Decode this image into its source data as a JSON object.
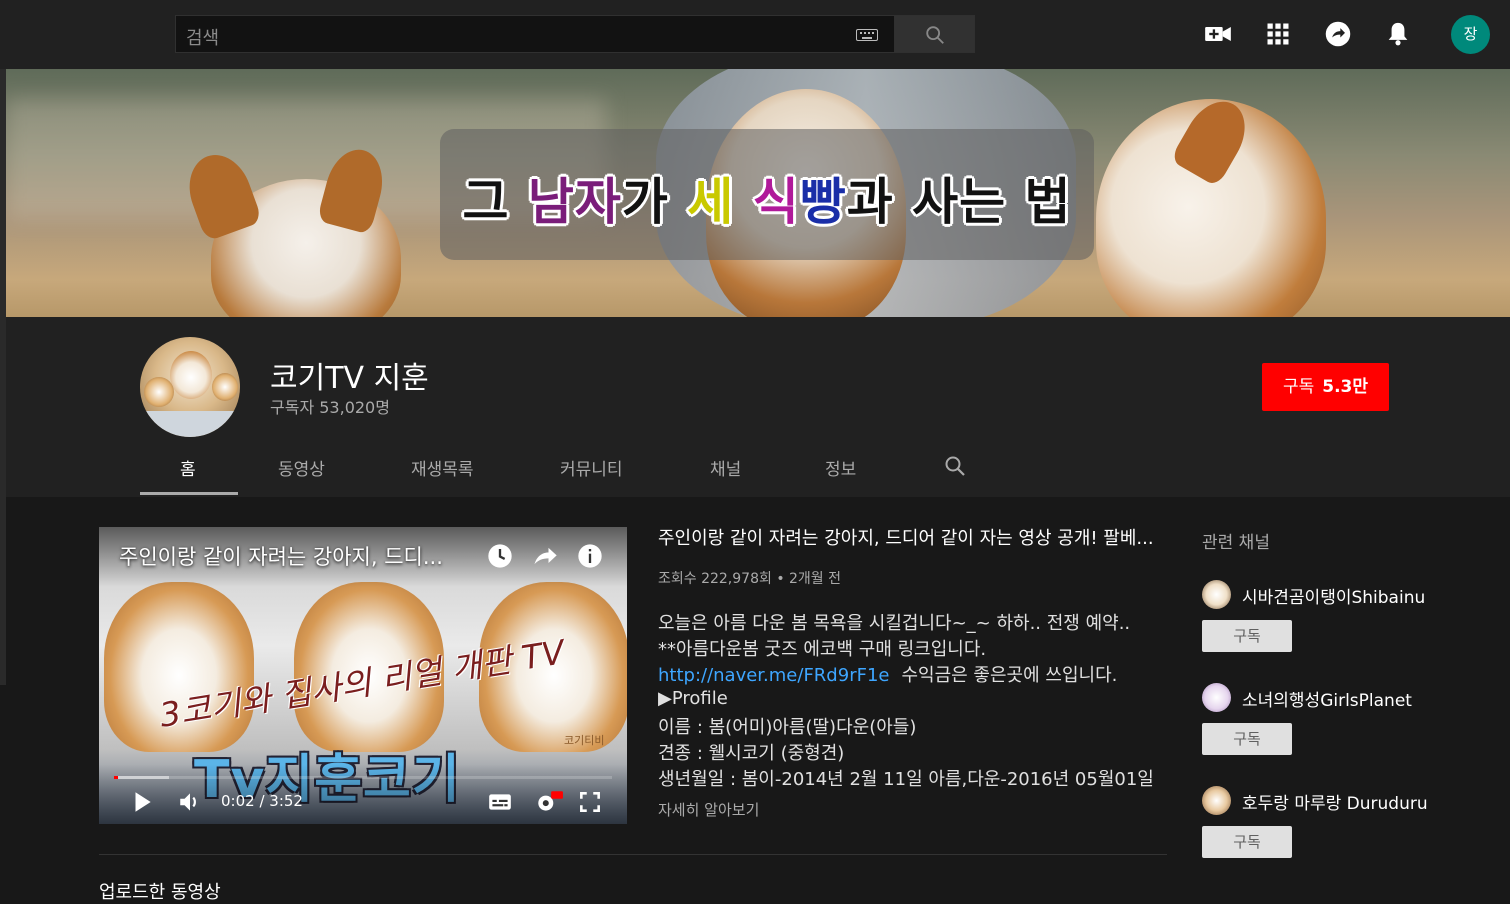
{
  "search": {
    "placeholder": "검색"
  },
  "user": {
    "avatar_letter": "장",
    "avatar_color": "#00897b"
  },
  "banner": {
    "title_parts": [
      "그 ",
      "남자",
      "가 ",
      "세",
      " ",
      "식",
      "빵",
      "과 사는 법"
    ]
  },
  "channel": {
    "name": "코기TV 지훈",
    "subscribers": "구독자 53,020명",
    "subscribe_label": "구독",
    "subscribe_count": "5.3만"
  },
  "tabs": [
    "홈",
    "동영상",
    "재생목록",
    "커뮤니티",
    "채널",
    "정보"
  ],
  "featured": {
    "player_title": "주인이랑 같이 자려는 강아지, 드디...",
    "overlay_text": "3코기와 집사의 리얼 개판 TV",
    "brand_text": "Tv지훈코기",
    "watermark": "코기티비",
    "time": "0:02 / 3:52",
    "progress_fraction": 0.009,
    "buffer_fraction": 0.11,
    "title": "주인이랑 같이 자려는 강아지, 드디어 같이 자는 영상 공개! 팔베...",
    "meta": "조회수 222,978회 • 2개월 전",
    "desc_line1": "오늘은 아름 다운 봄 목욕을 시킬겁니다~_~ 하하.. 전쟁 예약..",
    "desc_line2": "**아름다운봄 굿즈 에코백 구매 링크입니다.",
    "desc_link": "http://naver.me/FRd9rF1e",
    "desc_link_suffix": "수익금은 좋은곳에 쓰입니다.",
    "desc_line4": "▶Profile",
    "desc_line5": "이름 : 봄(어미)아름(딸)다운(아들)",
    "desc_line6": "견종 : 웰시코기 (중형견)",
    "desc_line7": "생년월일 : 봄이-2014년 2월 11일 아름,다운-2016년 05월01일",
    "more": "자세히 알아보기"
  },
  "next_section_title": "업로드한 동영상",
  "related": {
    "heading": "관련 채널",
    "channels": [
      {
        "name": "시바견곰이탱이Shibainu",
        "button": "구독"
      },
      {
        "name": "소녀의행성GirlsPlanet",
        "button": "구독"
      },
      {
        "name": "호두랑 마루랑 Duruduru",
        "button": "구독"
      }
    ]
  },
  "colors": {
    "accent_red": "#ff0000",
    "link": "#3ea6ff",
    "bg": "#181818",
    "header_bg": "#212121"
  }
}
